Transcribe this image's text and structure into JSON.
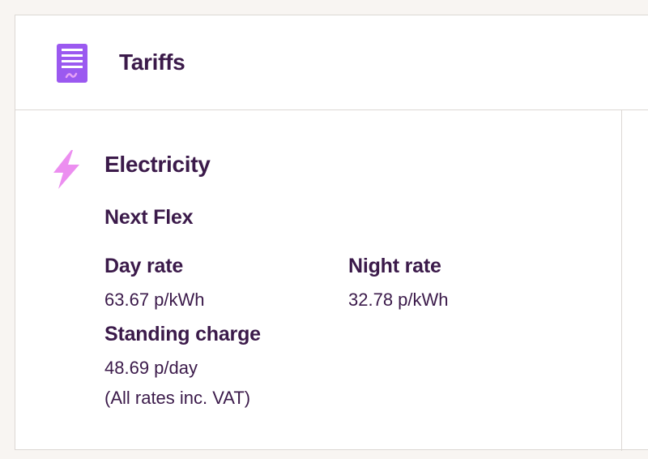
{
  "header": {
    "title": "Tariffs",
    "icon": "document-icon",
    "icon_color": "#9b59f0"
  },
  "electricity": {
    "icon": "lightning-bolt-icon",
    "icon_color": "#ec8ef0",
    "title": "Electricity",
    "tariff_name": "Next Flex",
    "day_rate_label": "Day rate",
    "day_rate_value": "63.67 p/kWh",
    "night_rate_label": "Night rate",
    "night_rate_value": "32.78 p/kWh",
    "standing_charge_label": "Standing charge",
    "standing_charge_value": "48.69 p/day",
    "vat_note": "(All rates inc. VAT)"
  },
  "colors": {
    "text": "#3b1a4a",
    "background": "#f8f5f2",
    "card": "#ffffff",
    "border": "#dcd8d4"
  }
}
